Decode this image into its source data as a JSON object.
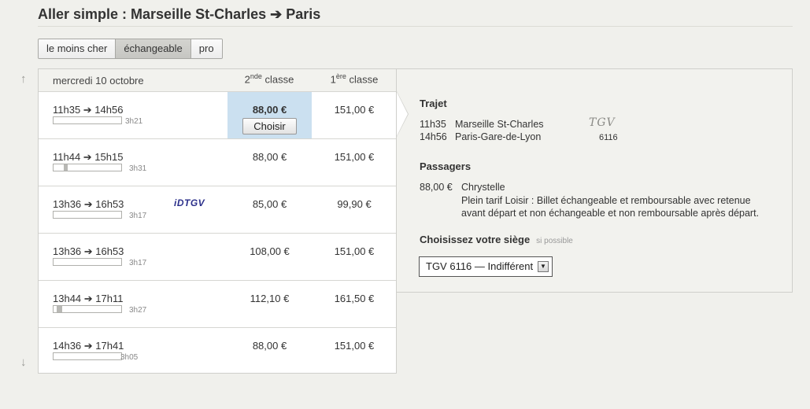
{
  "page": {
    "title": "Aller simple : Marseille St-Charles ➔ Paris"
  },
  "filters": [
    {
      "label": "le moins cher",
      "active": false
    },
    {
      "label": "échangeable",
      "active": true
    },
    {
      "label": "pro",
      "active": false
    }
  ],
  "nav": {
    "up_icon": "↑",
    "down_icon": "↓"
  },
  "results": {
    "date": "mercredi 10 octobre",
    "col2": {
      "num": "2",
      "sup": "nde",
      "rest": " classe"
    },
    "col1": {
      "num": "1",
      "sup": "ère",
      "rest": " classe"
    },
    "choose_label": "Choisir",
    "rows": [
      {
        "times": "11h35 ➔ 14h56",
        "duration": "3h21",
        "bar_offset": 0.0,
        "bar_fill": 0.0,
        "brand": "",
        "price2": "88,00 €",
        "price1": "151,00 €",
        "selected": true
      },
      {
        "times": "11h44 ➔ 15h15",
        "duration": "3h31",
        "bar_offset": 0.15,
        "bar_fill": 0.06,
        "brand": "",
        "price2": "88,00 €",
        "price1": "151,00 €",
        "selected": false
      },
      {
        "times": "13h36 ➔ 16h53",
        "duration": "3h17",
        "bar_offset": 0.0,
        "bar_fill": 0.0,
        "brand": "iDTGV",
        "price2": "85,00 €",
        "price1": "99,90 €",
        "selected": false
      },
      {
        "times": "13h36 ➔ 16h53",
        "duration": "3h17",
        "bar_offset": 0.0,
        "bar_fill": 0.0,
        "brand": "",
        "price2": "108,00 €",
        "price1": "151,00 €",
        "selected": false
      },
      {
        "times": "13h44 ➔ 17h11",
        "duration": "3h27",
        "bar_offset": 0.05,
        "bar_fill": 0.08,
        "brand": "",
        "price2": "112,10 €",
        "price1": "161,50 €",
        "selected": false
      },
      {
        "times": "14h36 ➔ 17h41",
        "duration": "3h05",
        "bar_offset": 0.0,
        "bar_fill": 0.0,
        "brand": "",
        "price2": "88,00 €",
        "price1": "151,00 €",
        "selected": false
      }
    ]
  },
  "detail": {
    "trajet_heading": "Trajet",
    "dep_time": "11h35",
    "dep_station": "Marseille St-Charles",
    "arr_time": "14h56",
    "arr_station": "Paris-Gare-de-Lyon",
    "train_logo": "TGV",
    "train_number": "6116",
    "passengers_heading": "Passagers",
    "passenger_price": "88,00 €",
    "passenger_name": "Chrystelle",
    "fare_line1": "Plein tarif Loisir : Billet échangeable et remboursable avec retenue",
    "fare_line2": "avant départ et non échangeable et non remboursable après départ.",
    "seat_heading": "Choisissez votre siège",
    "seat_hint": "si possible",
    "seat_value": "TGV 6116 — Indifférent",
    "dropdown_icon": "▼"
  }
}
